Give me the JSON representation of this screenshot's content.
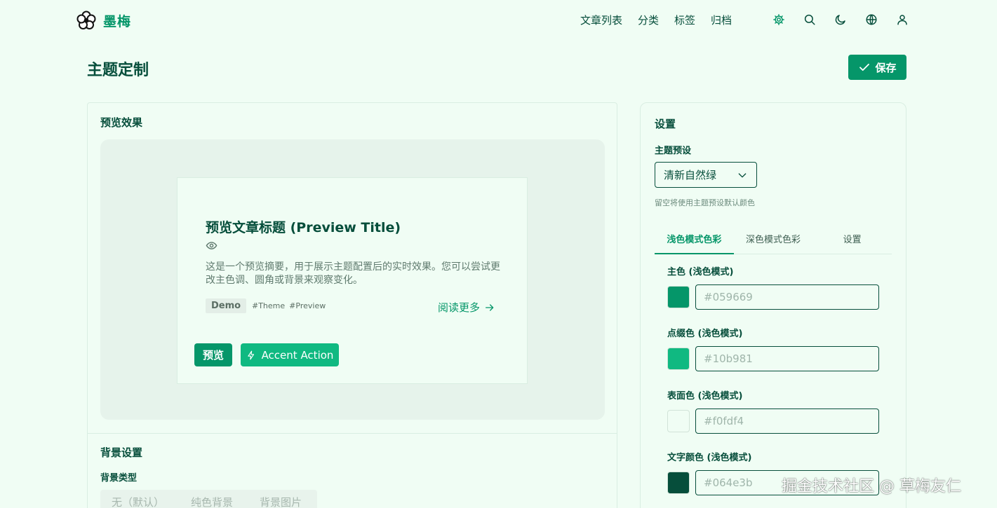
{
  "brand": {
    "name": "墨梅"
  },
  "nav": {
    "items": [
      "文章列表",
      "分类",
      "标签",
      "归档"
    ]
  },
  "page": {
    "title": "主题定制",
    "save_label": "保存"
  },
  "preview": {
    "heading": "预览效果",
    "article_title": "预览文章标题 (Preview Title)",
    "summary": "这是一个预览摘要，用于展示主题配置后的实时效果。您可以尝试更改主色调、圆角或背景来观察变化。",
    "badge": "Demo",
    "tags": [
      "#Theme",
      "#Preview"
    ],
    "read_more": "阅读更多",
    "btn_primary": "预览",
    "btn_accent": "Accent Action"
  },
  "background": {
    "heading": "背景设置",
    "type_label": "背景类型",
    "options": [
      "无（默认）",
      "纯色背景",
      "背景图片"
    ]
  },
  "settings": {
    "heading": "设置",
    "preset_label": "主题预设",
    "preset_value": "清新自然绿",
    "preset_hint": "留空将使用主题预设默认颜色",
    "tabs": [
      "浅色模式色彩",
      "深色模式色彩",
      "设置"
    ],
    "active_tab": "浅色模式色彩",
    "colors": [
      {
        "label": "主色 (浅色模式)",
        "placeholder": "#059669",
        "swatch": "#059669"
      },
      {
        "label": "点缀色 (浅色模式)",
        "placeholder": "#10b981",
        "swatch": "#10b981"
      },
      {
        "label": "表面色 (浅色模式)",
        "placeholder": "#f0fdf4",
        "swatch": "#f0fdf4"
      },
      {
        "label": "文字颜色 (浅色模式)",
        "placeholder": "#064e3b",
        "swatch": "#064e3b"
      }
    ]
  },
  "watermark": "掘金技术社区 @ 草梅友仁",
  "theme_colors": {
    "primary": "#059669",
    "accent": "#10b981",
    "surface": "#f0fdf4",
    "text": "#064e3b"
  },
  "icons": [
    "plum-blossom-logo",
    "gear-icon",
    "search-icon",
    "moon-icon",
    "globe-icon",
    "user-icon",
    "check-icon",
    "eye-icon",
    "arrow-right-icon",
    "bolt-icon",
    "chevron-down-icon"
  ]
}
